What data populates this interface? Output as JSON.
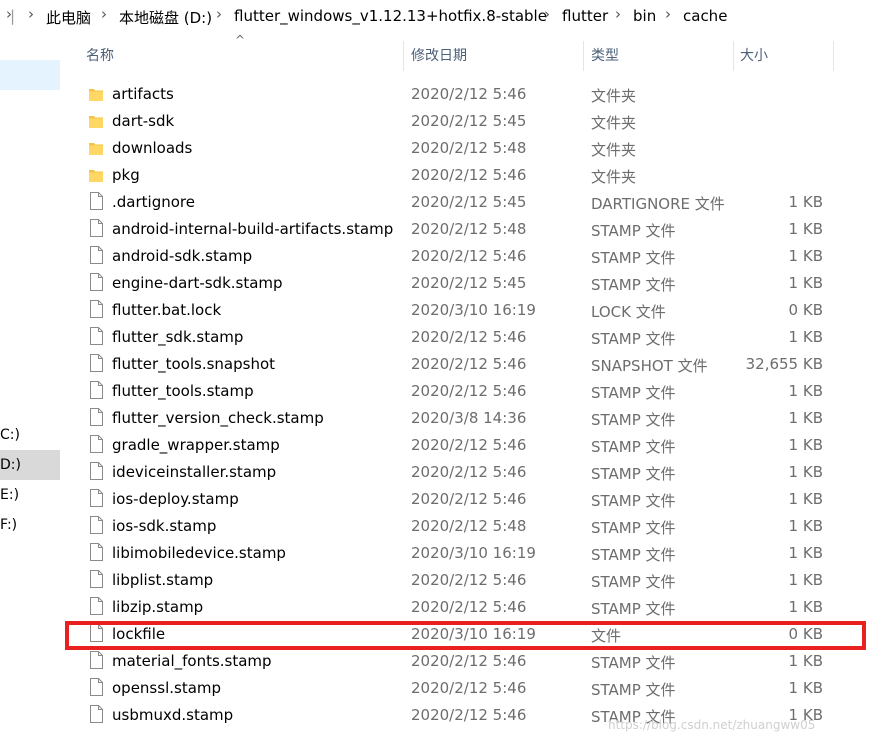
{
  "breadcrumb": [
    "此电脑",
    "本地磁盘 (D:)",
    "flutter_windows_v1.12.13+hotfix.8-stable",
    "flutter",
    "bin",
    "cache"
  ],
  "nav": {
    "items": [
      "C:)",
      "D:)",
      "E:)",
      "F:)"
    ]
  },
  "columns": {
    "name": "名称",
    "date": "修改日期",
    "type": "类型",
    "size": "大小"
  },
  "files": [
    {
      "name": "artifacts",
      "date": "2020/2/12 5:46",
      "type": "文件夹",
      "size": "",
      "icon": "folder-icon"
    },
    {
      "name": "dart-sdk",
      "date": "2020/2/12 5:45",
      "type": "文件夹",
      "size": "",
      "icon": "folder-icon"
    },
    {
      "name": "downloads",
      "date": "2020/2/12 5:48",
      "type": "文件夹",
      "size": "",
      "icon": "folder-icon"
    },
    {
      "name": "pkg",
      "date": "2020/2/12 5:46",
      "type": "文件夹",
      "size": "",
      "icon": "folder-icon"
    },
    {
      "name": ".dartignore",
      "date": "2020/2/12 5:45",
      "type": "DARTIGNORE 文件",
      "size": "1 KB",
      "icon": "file-icon"
    },
    {
      "name": "android-internal-build-artifacts.stamp",
      "date": "2020/2/12 5:48",
      "type": "STAMP 文件",
      "size": "1 KB",
      "icon": "file-icon"
    },
    {
      "name": "android-sdk.stamp",
      "date": "2020/2/12 5:46",
      "type": "STAMP 文件",
      "size": "1 KB",
      "icon": "file-icon"
    },
    {
      "name": "engine-dart-sdk.stamp",
      "date": "2020/2/12 5:45",
      "type": "STAMP 文件",
      "size": "1 KB",
      "icon": "file-icon"
    },
    {
      "name": "flutter.bat.lock",
      "date": "2020/3/10 16:19",
      "type": "LOCK 文件",
      "size": "0 KB",
      "icon": "file-icon"
    },
    {
      "name": "flutter_sdk.stamp",
      "date": "2020/2/12 5:46",
      "type": "STAMP 文件",
      "size": "1 KB",
      "icon": "file-icon"
    },
    {
      "name": "flutter_tools.snapshot",
      "date": "2020/2/12 5:46",
      "type": "SNAPSHOT 文件",
      "size": "32,655 KB",
      "icon": "file-icon"
    },
    {
      "name": "flutter_tools.stamp",
      "date": "2020/2/12 5:46",
      "type": "STAMP 文件",
      "size": "1 KB",
      "icon": "file-icon"
    },
    {
      "name": "flutter_version_check.stamp",
      "date": "2020/3/8 14:36",
      "type": "STAMP 文件",
      "size": "1 KB",
      "icon": "file-icon"
    },
    {
      "name": "gradle_wrapper.stamp",
      "date": "2020/2/12 5:46",
      "type": "STAMP 文件",
      "size": "1 KB",
      "icon": "file-icon"
    },
    {
      "name": "ideviceinstaller.stamp",
      "date": "2020/2/12 5:46",
      "type": "STAMP 文件",
      "size": "1 KB",
      "icon": "file-icon"
    },
    {
      "name": "ios-deploy.stamp",
      "date": "2020/2/12 5:46",
      "type": "STAMP 文件",
      "size": "1 KB",
      "icon": "file-icon"
    },
    {
      "name": "ios-sdk.stamp",
      "date": "2020/2/12 5:48",
      "type": "STAMP 文件",
      "size": "1 KB",
      "icon": "file-icon"
    },
    {
      "name": "libimobiledevice.stamp",
      "date": "2020/3/10 16:19",
      "type": "STAMP 文件",
      "size": "1 KB",
      "icon": "file-icon"
    },
    {
      "name": "libplist.stamp",
      "date": "2020/2/12 5:46",
      "type": "STAMP 文件",
      "size": "1 KB",
      "icon": "file-icon"
    },
    {
      "name": "libzip.stamp",
      "date": "2020/2/12 5:46",
      "type": "STAMP 文件",
      "size": "1 KB",
      "icon": "file-icon"
    },
    {
      "name": "lockfile",
      "date": "2020/3/10 16:19",
      "type": "文件",
      "size": "0 KB",
      "icon": "file-icon"
    },
    {
      "name": "material_fonts.stamp",
      "date": "2020/2/12 5:46",
      "type": "STAMP 文件",
      "size": "1 KB",
      "icon": "file-icon"
    },
    {
      "name": "openssl.stamp",
      "date": "2020/2/12 5:46",
      "type": "STAMP 文件",
      "size": "1 KB",
      "icon": "file-icon"
    },
    {
      "name": "usbmuxd.stamp",
      "date": "2020/2/12 5:46",
      "type": "STAMP 文件",
      "size": "1 KB",
      "icon": "file-icon"
    }
  ],
  "highlight_color": "#e8201f",
  "watermark": "https://blog.csdn.net/zhuangww05"
}
